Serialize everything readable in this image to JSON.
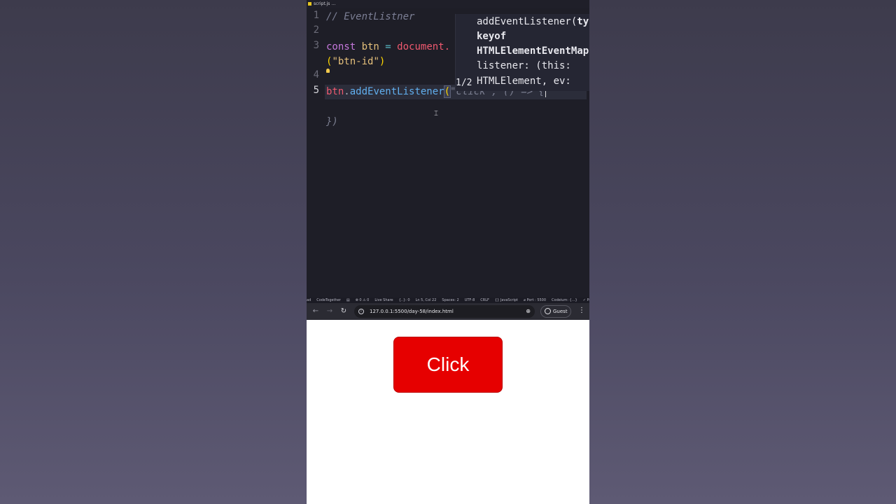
{
  "editor": {
    "tab_label": "script.js …",
    "lines": [
      {
        "num": "1",
        "parts": [
          [
            "c-comment",
            "// EventListner"
          ]
        ]
      },
      {
        "num": "2",
        "parts": []
      },
      {
        "num": "3",
        "parts": [
          [
            "c-kw",
            "const "
          ],
          [
            "c-var",
            "btn"
          ],
          [
            "c-op",
            " = "
          ],
          [
            "c-red",
            "document."
          ]
        ]
      },
      {
        "num": "",
        "parts": [
          [
            "c-brace",
            "("
          ],
          [
            "c-str",
            "\"btn-id\""
          ],
          [
            "c-brace",
            ")"
          ]
        ]
      },
      {
        "num": "4",
        "parts": []
      },
      {
        "num": "5",
        "parts": [
          [
            "c-red",
            "btn"
          ],
          [
            "c-plain",
            "."
          ],
          [
            "c-fn",
            "addEventListener"
          ],
          [
            "paren",
            "("
          ],
          [
            "c-ghost",
            "\"click\", () => {"
          ]
        ]
      },
      {
        "num": "",
        "parts": []
      },
      {
        "num": "",
        "parts": [
          [
            "c-ghost",
            "})"
          ]
        ]
      }
    ],
    "hover": {
      "lines": [
        {
          "text": "addEventListener(ty",
          "bold_tail": ""
        },
        {
          "text": "keyof",
          "bold": true
        },
        {
          "text": "HTMLElementEventMap",
          "bold": true
        },
        {
          "text": "listener: (this:"
        },
        {
          "text": "HTMLElement, ev:"
        }
      ],
      "counter": "1/2"
    }
  },
  "statusbar": {
    "items": [
      "ad",
      "CodeTogether",
      "▤",
      "⊗ 0 ⚠ 0",
      "Live Share",
      "{..}: 0",
      "Ln 5, Col 22",
      "Spaces: 2",
      "UTF-8",
      "CRLF",
      "{} JavaScript",
      "⌀ Port : 5500",
      "Codeium: {...}",
      "✓ Pret"
    ]
  },
  "browser": {
    "url": "127.0.0.1:5500/day-58/index.html",
    "profile_label": "Guest",
    "back_icon": "←",
    "forward_icon": "→",
    "reload_icon": "↻",
    "zoom_icon": "⊕",
    "menu_icon": "⋮"
  },
  "page": {
    "button_label": "Click",
    "button_color": "#e60000"
  }
}
